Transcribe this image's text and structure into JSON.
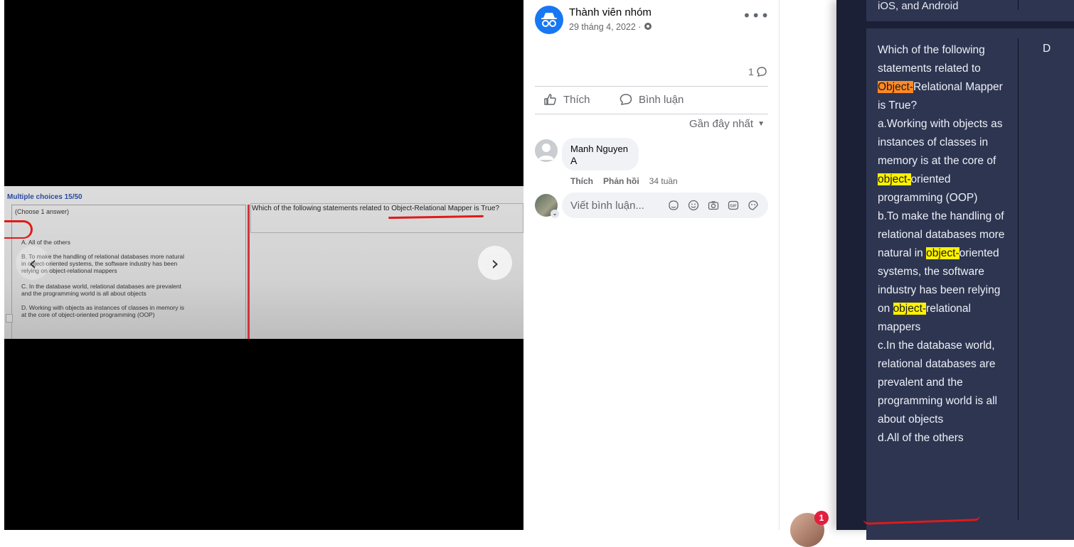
{
  "viewer": {
    "photo": {
      "mc_title": "Multiple choices 15/50",
      "choose_label": "(Choose 1 answer)",
      "question": "Which of the following statements related to Object-Relational Mapper is True?",
      "options": [
        "A. All of the others",
        "B. To make the handling of relational databases more natural in object-oriented systems, the software industry has been relying on object-relational mappers",
        "C. In the database world, relational databases are prevalent and the programming world is all about objects",
        "D. Working with objects as instances of classes in memory is at the core of object-oriented programming (OOP)"
      ]
    },
    "prev_icon": "chevron-left-icon",
    "next_icon": "chevron-right-icon"
  },
  "post": {
    "author": "Thành viên nhóm",
    "date": "29 tháng 4, 2022 ·",
    "privacy_icon": "globe-icon",
    "comment_count": "1",
    "like_label": "Thích",
    "comment_label": "Bình luận",
    "sort_label": "Gần đây nhất"
  },
  "comments": [
    {
      "name": "Manh Nguyen",
      "text": "A",
      "like": "Thích",
      "reply": "Phản hồi",
      "time": "34 tuần"
    }
  ],
  "composer": {
    "placeholder": "Viết bình luận..."
  },
  "chat": {
    "badge": "1"
  },
  "side_card": {
    "prev_text": "iOS, and Android",
    "answer": "D",
    "q_parts": {
      "p1": "Which of the following statements related to ",
      "h1": "Object-",
      "p2": "Relational Mapper is True?",
      "a1": "a.Working with objects as instances of classes in memory is at the core of ",
      "h2": "object-",
      "a2": "oriented programming (OOP)",
      "b1": "b.To make the handling of relational databases more natural in ",
      "h3": "object-",
      "b2": "oriented systems, the software industry has been relying on ",
      "h4": "object-",
      "b3": "relational mappers",
      "c": "c.In the database world, relational databases are prevalent and the programming world is all about objects",
      "d": "d.All of the others"
    }
  }
}
